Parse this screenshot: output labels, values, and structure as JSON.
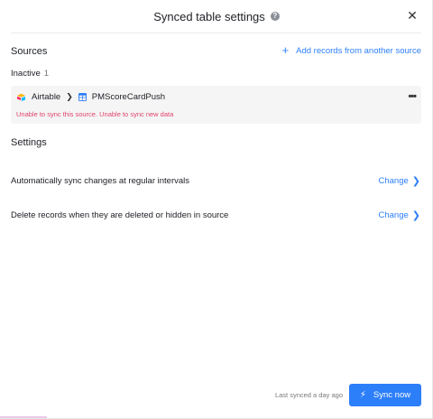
{
  "header": {
    "title": "Synced table settings",
    "help_icon": "help-circle-icon",
    "close_icon": "close-icon"
  },
  "sources": {
    "title": "Sources",
    "add_label": "Add records from another source",
    "inactive_label": "Inactive",
    "inactive_count": "1",
    "items": [
      {
        "provider": "Airtable",
        "table": "PMScoreCardPush",
        "error": "Unable to sync this source. Unable to sync new data"
      }
    ]
  },
  "settings": {
    "title": "Settings",
    "rows": [
      {
        "label": "Automatically sync changes at regular intervals",
        "action": "Change"
      },
      {
        "label": "Delete records when they are deleted or hidden in source",
        "action": "Change"
      }
    ]
  },
  "footer": {
    "last_synced": "Last synced a day ago",
    "sync_label": "Sync now"
  },
  "colors": {
    "accent": "#2d7ff9",
    "error": "#e0436c",
    "card_bg": "#f5f5f5"
  }
}
